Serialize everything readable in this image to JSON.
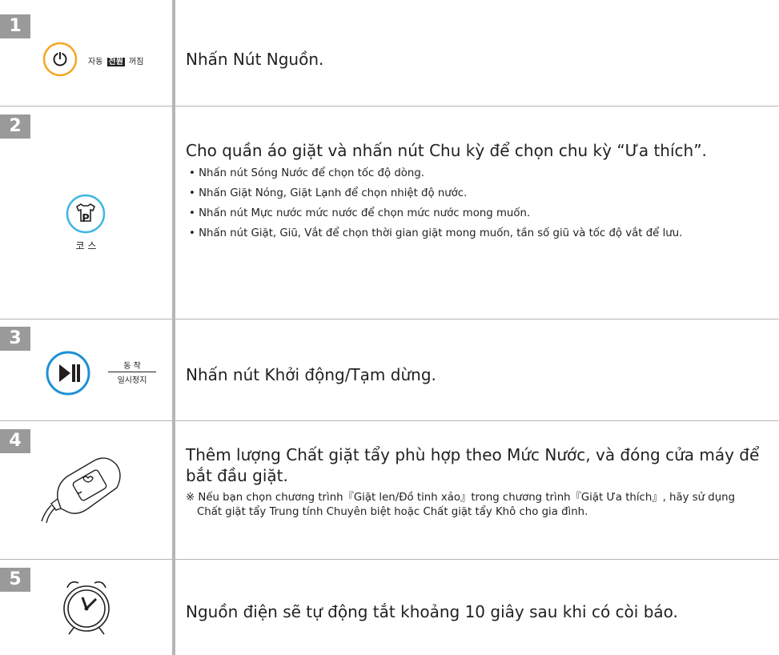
{
  "steps": [
    {
      "number": "1",
      "icon": "power-icon",
      "icon_color": "#f5a623",
      "icon_caption": {
        "pre": "자동",
        "highlight": "전원",
        "post": "꺼짐"
      },
      "heading": "Nhấn Nút Nguồn."
    },
    {
      "number": "2",
      "icon": "course-tshirt-icon",
      "icon_color": "#3fb6e3",
      "icon_caption": "코 스",
      "heading": "Cho quần áo giặt và nhấn nút Chu kỳ để chọn chu kỳ “Ưa thích”.",
      "bullets": [
        "Nhấn nút Sóng Nước để chọn tốc độ dòng.",
        "Nhấn Giặt Nóng, Giặt Lạnh để chọn nhiệt độ nước.",
        "Nhấn nút Mực nước mức nước để chọn mức nước mong muốn.",
        "Nhấn nút Giặt, Giũ, Vắt để chọn thời gian giặt mong muốn, tần số giũ và tốc độ vắt để lưu."
      ]
    },
    {
      "number": "3",
      "icon": "play-pause-icon",
      "icon_color": "#1e90d6",
      "icon_caption": {
        "top": "동 작",
        "bottom": "일시정지"
      },
      "heading": "Nhấn nút Khởi động/Tạm dừng."
    },
    {
      "number": "4",
      "icon": "detergent-bottle-icon",
      "heading": "Thêm lượng Chất giặt tẩy phù hợp theo Mức Nước, và đóng cửa máy để bắt đầu giặt.",
      "note": "※ Nếu bạn chọn chương trình『Giặt  len/Đồ tinh xảo』trong chương trình『Giặt Ưa thích』, hãy sử dụng Chất giặt tẩy Trung tính Chuyên biệt hoặc Chất giặt tẩy Khô cho gia đình."
    },
    {
      "number": "5",
      "icon": "alarm-clock-icon",
      "heading": "Nguồn điện sẽ tự động tắt khoảng 10 giây sau khi có còi báo."
    }
  ]
}
